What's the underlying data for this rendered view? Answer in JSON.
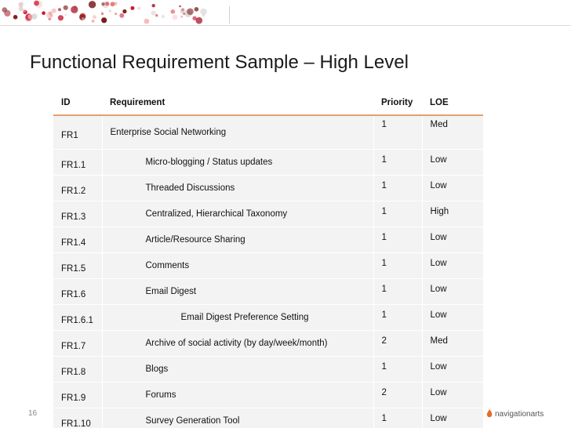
{
  "slide": {
    "title": "Functional Requirement Sample – High Level",
    "number": "16",
    "logo_text": "navigationarts"
  },
  "table": {
    "headers": [
      "ID",
      "Requirement",
      "Priority",
      "LOE"
    ],
    "rows": [
      {
        "id": "FR1",
        "requirement": "Enterprise Social Networking",
        "level": 0,
        "priority": "1",
        "loe": "Med"
      },
      {
        "id": "FR1.1",
        "requirement": "Micro-blogging / Status updates",
        "level": 1,
        "priority": "1",
        "loe": "Low"
      },
      {
        "id": "FR1.2",
        "requirement": "Threaded Discussions",
        "level": 1,
        "priority": "1",
        "loe": "Low"
      },
      {
        "id": "FR1.3",
        "requirement": "Centralized, Hierarchical Taxonomy",
        "level": 1,
        "priority": "1",
        "loe": "High"
      },
      {
        "id": "FR1.4",
        "requirement": "Article/Resource Sharing",
        "level": 1,
        "priority": "1",
        "loe": "Low"
      },
      {
        "id": "FR1.5",
        "requirement": "Comments",
        "level": 1,
        "priority": "1",
        "loe": "Low"
      },
      {
        "id": "FR1.6",
        "requirement": "Email Digest",
        "level": 1,
        "priority": "1",
        "loe": "Low"
      },
      {
        "id": "FR1.6.1",
        "requirement": "Email Digest Preference Setting",
        "level": 2,
        "priority": "1",
        "loe": "Low"
      },
      {
        "id": "FR1.7",
        "requirement": "Archive of social activity (by day/week/month)",
        "level": 1,
        "priority": "2",
        "loe": "Med"
      },
      {
        "id": "FR1.8",
        "requirement": "Blogs",
        "level": 1,
        "priority": "1",
        "loe": "Low"
      },
      {
        "id": "FR1.9",
        "requirement": "Forums",
        "level": 1,
        "priority": "2",
        "loe": "Low"
      },
      {
        "id": "FR1.10",
        "requirement": "Survey Generation Tool",
        "level": 1,
        "priority": "1",
        "loe": "Low"
      }
    ]
  },
  "colors": {
    "header_rule": "#e2a070",
    "row_fill": "#f3f3f3",
    "dots": [
      "#c8102e",
      "#e05a5a",
      "#f2a0a0",
      "#7a1a1a",
      "#d9d9d9",
      "#b03040",
      "#f6c9c9"
    ]
  }
}
